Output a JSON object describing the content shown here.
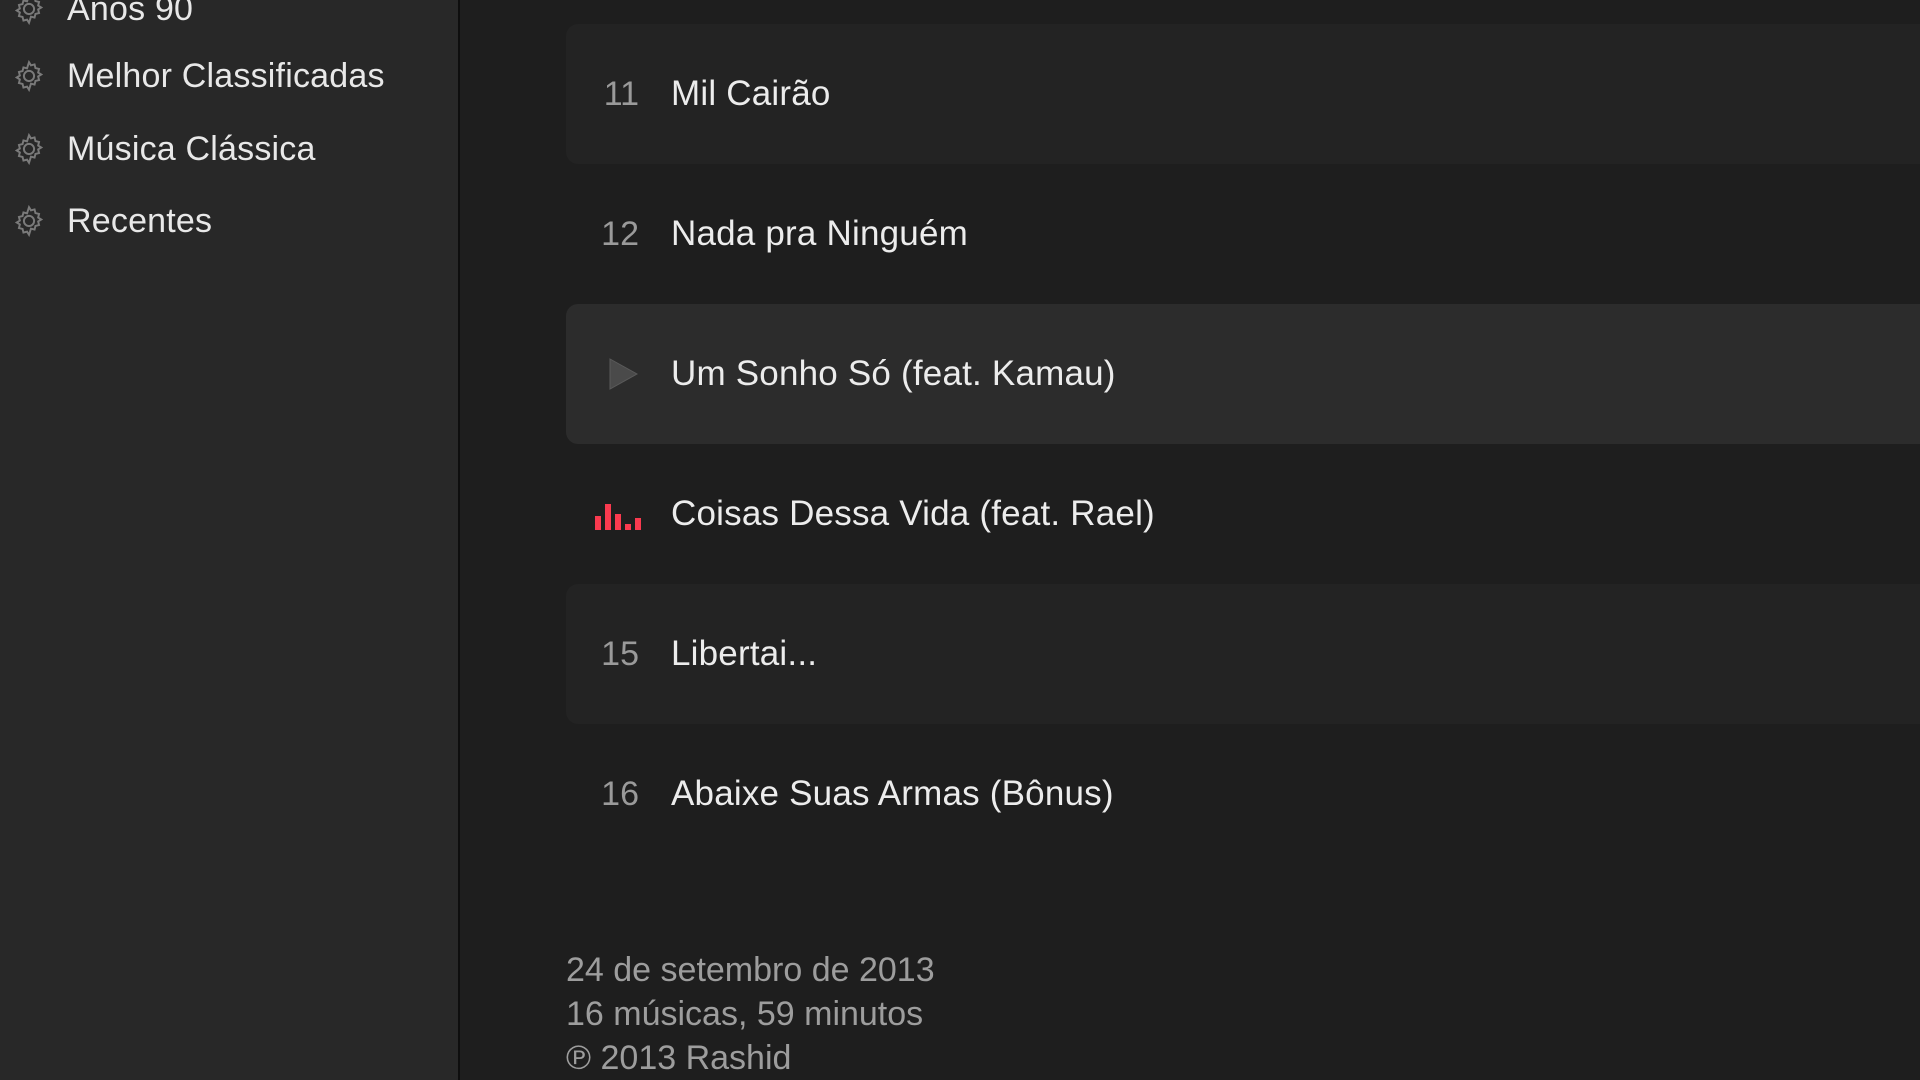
{
  "sidebar": {
    "items": [
      {
        "label": "Anos 90",
        "icon": "gear-icon"
      },
      {
        "label": "Melhor Classificadas",
        "icon": "gear-icon"
      },
      {
        "label": "Música Clássica",
        "icon": "gear-icon"
      },
      {
        "label": "Recentes",
        "icon": "gear-icon"
      }
    ]
  },
  "tracks": [
    {
      "number": "11",
      "title": "Mil Cairão",
      "state": "normal"
    },
    {
      "number": "12",
      "title": "Nada pra Ninguém",
      "state": "normal"
    },
    {
      "number": "",
      "title": "Um Sonho Só (feat. Kamau)",
      "state": "hover-play"
    },
    {
      "number": "",
      "title": "Coisas Dessa Vida (feat. Rael)",
      "state": "now-playing"
    },
    {
      "number": "15",
      "title": "Libertai...",
      "state": "normal"
    },
    {
      "number": "16",
      "title": "Abaixe Suas Armas (Bônus)",
      "state": "normal"
    }
  ],
  "album_info": {
    "release_date": "24 de setembro de 2013",
    "summary": "16 músicas, 59 minutos",
    "copyright": "℗ 2013 Rashid"
  },
  "colors": {
    "background": "#1e1e1e",
    "sidebar": "#282828",
    "accent": "#fa3a4f",
    "text": "#ececec",
    "secondary_text": "#9d9d9d"
  }
}
